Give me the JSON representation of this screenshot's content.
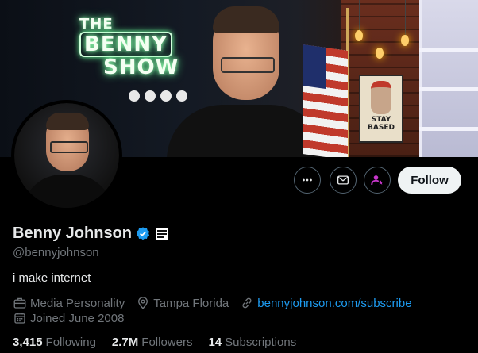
{
  "banner": {
    "neon_line1": "THE",
    "neon_line2": "BENNY",
    "neon_line3": "SHOW",
    "poster_line1": "STAY",
    "poster_line2": "BASED"
  },
  "actions": {
    "more_icon": "more-horizontal-icon",
    "message_icon": "envelope-icon",
    "subscribe_icon": "person-star-icon",
    "follow_label": "Follow"
  },
  "profile": {
    "name": "Benny Johnson",
    "handle": "@bennyjohnson",
    "bio": "i make internet",
    "category": "Media Personality",
    "location": "Tampa Florida",
    "link_text": "bennyjohnson.com/subscribe",
    "joined": "Joined June 2008"
  },
  "stats": {
    "following_count": "3,415",
    "following_label": "Following",
    "followers_count": "2.7M",
    "followers_label": "Followers",
    "subscriptions_count": "14",
    "subscriptions_label": "Subscriptions"
  },
  "colors": {
    "background": "#000000",
    "text_primary": "#e7e9ea",
    "text_secondary": "#71767b",
    "link": "#1d9bf0",
    "verified": "#1d9bf0",
    "subscribe_accent": "#c936cc",
    "button_border": "#536471",
    "follow_bg": "#eff3f4"
  }
}
